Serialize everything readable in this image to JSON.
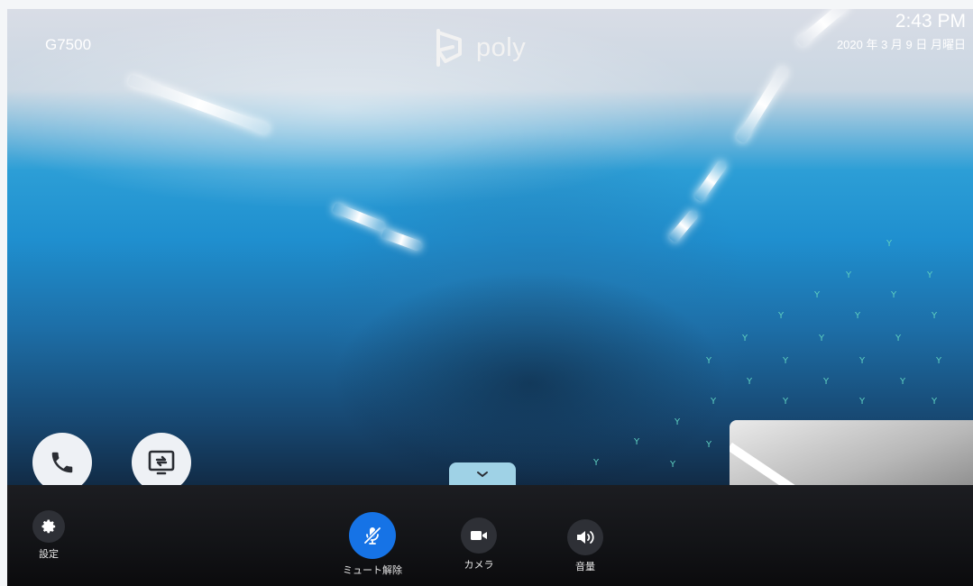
{
  "header": {
    "device_name": "G7500",
    "logo_text": "poly",
    "time": "2:43 PM",
    "date": "2020 年 3 月 9 日 月曜日"
  },
  "controls": {
    "settings_label": "設定",
    "mute_label": "ミュート解除",
    "camera_label": "カメラ",
    "volume_label": "音量"
  },
  "colors": {
    "mute_active": "#1673e6",
    "control_bg": "#2e3036",
    "bottom_bar": "#141518",
    "expand_tab": "#9fd2e6"
  },
  "icons": [
    "phone-icon",
    "content-share-icon",
    "chevron-down-icon",
    "gear-icon",
    "microphone-muted-icon",
    "video-camera-icon",
    "speaker-icon",
    "poly-logo-icon"
  ]
}
